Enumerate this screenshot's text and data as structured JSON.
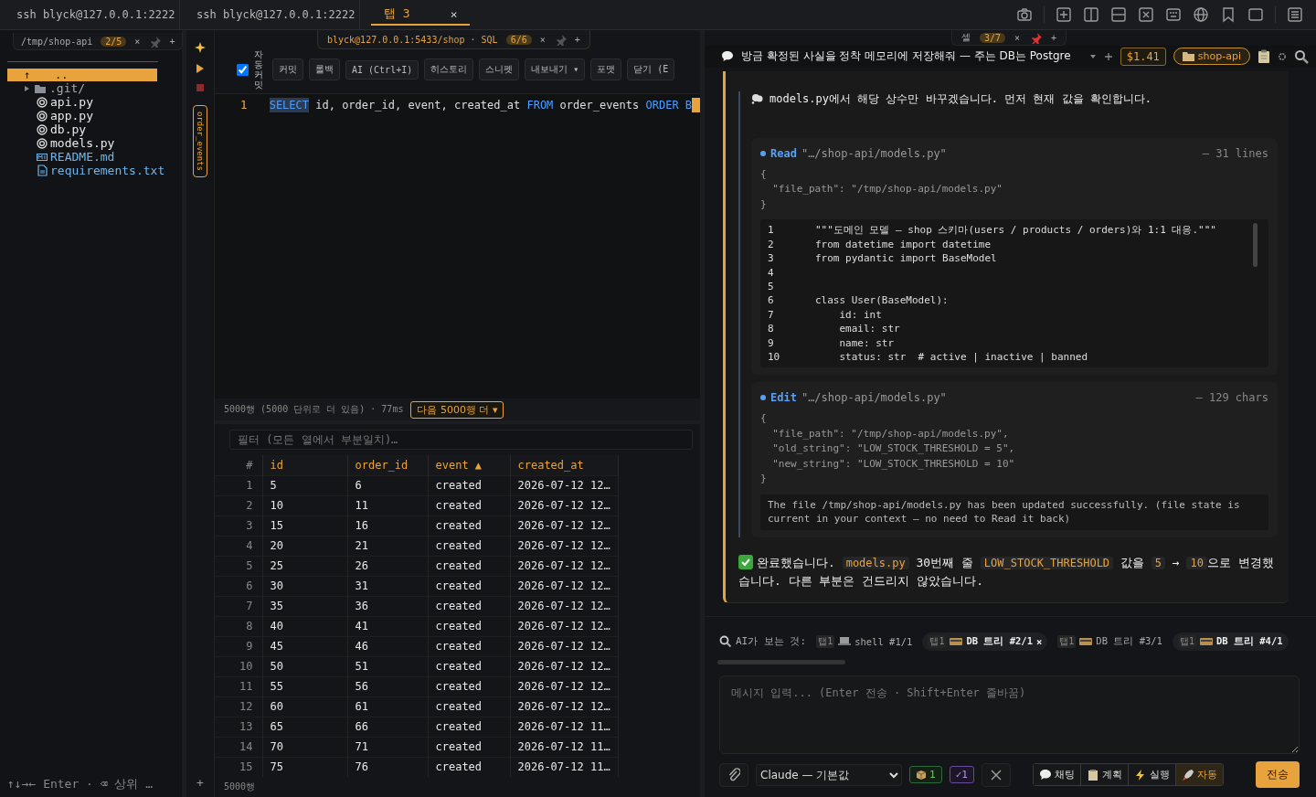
{
  "top_tabs": [
    {
      "label": "ssh blyck@127.0.0.1:2222",
      "selected": false
    },
    {
      "label": "ssh blyck@127.0.0.1:2222",
      "selected": false
    },
    {
      "label": "탭 3",
      "selected": true,
      "close": "×"
    }
  ],
  "file_pane": {
    "path": "/tmp/shop-api",
    "count": "2/5",
    "close": "×",
    "add": "+",
    "parent": {
      "arrow": "↑",
      "label": "..",
      "selected": true
    },
    "items": [
      {
        "kind": "folder",
        "name": ".git/"
      },
      {
        "kind": "python",
        "name": "api.py"
      },
      {
        "kind": "python",
        "name": "app.py"
      },
      {
        "kind": "python",
        "name": "db.py"
      },
      {
        "kind": "python",
        "name": "models.py"
      },
      {
        "kind": "markdown",
        "name": "README.md"
      },
      {
        "kind": "text",
        "name": "requirements.txt"
      }
    ],
    "hint": "↑↓→← Enter · ⌫ 상위 …"
  },
  "sql": {
    "connection": "blyck@127.0.0.1:5433/shop · SQL",
    "count": "6/6",
    "close": "×",
    "add": "+",
    "side_tab": "order_events",
    "autocommit": {
      "label": "자동커밋",
      "checked": true
    },
    "buttons": [
      "커밋",
      "롤백",
      "AI (Ctrl+I)",
      "히스토리",
      "스니펫",
      "내보내기 ▾",
      "포맷",
      "닫기 (E"
    ],
    "editor": {
      "line_number": "1",
      "tokens": [
        {
          "kind": "keyword",
          "text": "SELECT",
          "selected": true
        },
        {
          "kind": "plain",
          "text": " id, order_id, event, created_at ",
          "selected": false
        },
        {
          "kind": "keyword",
          "text": "FROM",
          "selected": false
        },
        {
          "kind": "plain",
          "text": " order_events ",
          "selected": false
        },
        {
          "kind": "keyword",
          "text": "ORDER B",
          "selected": false
        }
      ]
    },
    "status": "5000행 (5000 단위로 더 있음) · 77ms",
    "more_button": "다음 5000행 더 ▾",
    "filter_placeholder": "필터 (모든 열에서 부분일치)…",
    "table": {
      "columns": [
        "#",
        "id",
        "order_id",
        "event ▲",
        "created_at"
      ],
      "rows": [
        [
          "1",
          "5",
          "6",
          "created",
          "2026-07-12 12…"
        ],
        [
          "2",
          "10",
          "11",
          "created",
          "2026-07-12 12…"
        ],
        [
          "3",
          "15",
          "16",
          "created",
          "2026-07-12 12…"
        ],
        [
          "4",
          "20",
          "21",
          "created",
          "2026-07-12 12…"
        ],
        [
          "5",
          "25",
          "26",
          "created",
          "2026-07-12 12…"
        ],
        [
          "6",
          "30",
          "31",
          "created",
          "2026-07-12 12…"
        ],
        [
          "7",
          "35",
          "36",
          "created",
          "2026-07-12 12…"
        ],
        [
          "8",
          "40",
          "41",
          "created",
          "2026-07-12 12…"
        ],
        [
          "9",
          "45",
          "46",
          "created",
          "2026-07-12 12…"
        ],
        [
          "10",
          "50",
          "51",
          "created",
          "2026-07-12 12…"
        ],
        [
          "11",
          "55",
          "56",
          "created",
          "2026-07-12 12…"
        ],
        [
          "12",
          "60",
          "61",
          "created",
          "2026-07-12 12…"
        ],
        [
          "13",
          "65",
          "66",
          "created",
          "2026-07-12 11…"
        ],
        [
          "14",
          "70",
          "71",
          "created",
          "2026-07-12 11…"
        ],
        [
          "15",
          "75",
          "76",
          "created",
          "2026-07-12 11…"
        ]
      ]
    },
    "footer": "5000행",
    "add_button": "+"
  },
  "chat": {
    "cell_tab": {
      "label": "셀",
      "count": "3/7",
      "close": "×",
      "add": "+"
    },
    "title": "방금 확정된 사실을 정착 메모리에 저장해줘 — 주는 DB는 Postgre",
    "cost": "$1.41",
    "project": "shop-api",
    "thought": "models.py에서 해당 상수만 바꾸겠습니다. 먼저 현재 값을 확인합니다.",
    "tool_calls": [
      {
        "tool": "Read",
        "path": "\"…/shop-api/models.py\"",
        "meta": "— 31 lines",
        "args": "{\n  \"file_path\": \"/tmp/shop-api/models.py\"\n}",
        "kind": "code",
        "lines": [
          {
            "number": "1",
            "code": "\"\"\"도메인 모델 — shop 스키마(users / products / orders)와 1:1 대응.\"\"\""
          },
          {
            "number": "2",
            "code": "from datetime import datetime"
          },
          {
            "number": "3",
            "code": "from pydantic import BaseModel"
          },
          {
            "number": "4"
          },
          {
            "number": "5"
          },
          {
            "number": "6",
            "code": "class User(BaseModel):"
          },
          {
            "number": "7",
            "code": "    id: int"
          },
          {
            "number": "8",
            "code": "    email: str"
          },
          {
            "number": "9",
            "code": "    name: str"
          },
          {
            "number": "10",
            "code": "    status: str  # active | inactive | banned"
          }
        ]
      },
      {
        "tool": "Edit",
        "path": "\"…/shop-api/models.py\"",
        "meta": "— 129 chars",
        "args": "{\n  \"file_path\": \"/tmp/shop-api/models.py\",\n  \"old_string\": \"LOW_STOCK_THRESHOLD = 5\",\n  \"new_string\": \"LOW_STOCK_THRESHOLD = 10\"\n}",
        "kind": "text",
        "result": "The file /tmp/shop-api/models.py has been updated successfully. (file state is current in your context — no need to Read it back)"
      }
    ],
    "final": [
      {
        "kind": "text",
        "text": "완료했습니다. "
      },
      {
        "kind": "code",
        "text": "models.py"
      },
      {
        "kind": "text",
        "text": " 30번째 줄 "
      },
      {
        "kind": "code",
        "text": "LOW_STOCK_THRESHOLD"
      },
      {
        "kind": "text",
        "text": " 값을 "
      },
      {
        "kind": "code",
        "text": "5"
      },
      {
        "kind": "text",
        "text": " → "
      },
      {
        "kind": "code",
        "text": "10"
      },
      {
        "kind": "text",
        "text": "으로 변경했습니다. 다른 부분은 건드리지 않았습니다."
      }
    ],
    "context_label": "AI가 보는 것:",
    "context_chips": [
      {
        "tab": "탭1",
        "kind": "terminal",
        "label": "shell #1/1",
        "selected": false
      },
      {
        "tab": "탭1",
        "kind": "tree",
        "label": "DB 트리 #2/1",
        "selected": true,
        "close": "×"
      },
      {
        "tab": "탭1",
        "kind": "tree",
        "label": "DB 트리 #3/1",
        "selected": false
      },
      {
        "tab": "탭1",
        "kind": "tree",
        "label": "DB 트리 #4/1",
        "selected": true
      }
    ],
    "input_placeholder": "메시지 입력... (Enter 전송 · Shift+Enter 줄바꿈)",
    "model": "Claude — 기본값",
    "badges": [
      {
        "kind": "box",
        "text": "1"
      },
      {
        "kind": "check",
        "text": "✓1"
      }
    ],
    "modes": [
      {
        "kind": "chat",
        "label": "채팅",
        "selected": false
      },
      {
        "kind": "plan",
        "label": "계획",
        "selected": false
      },
      {
        "kind": "run",
        "label": "실행",
        "selected": false
      },
      {
        "kind": "auto",
        "label": "자동",
        "selected": true
      }
    ],
    "send": "전송"
  }
}
